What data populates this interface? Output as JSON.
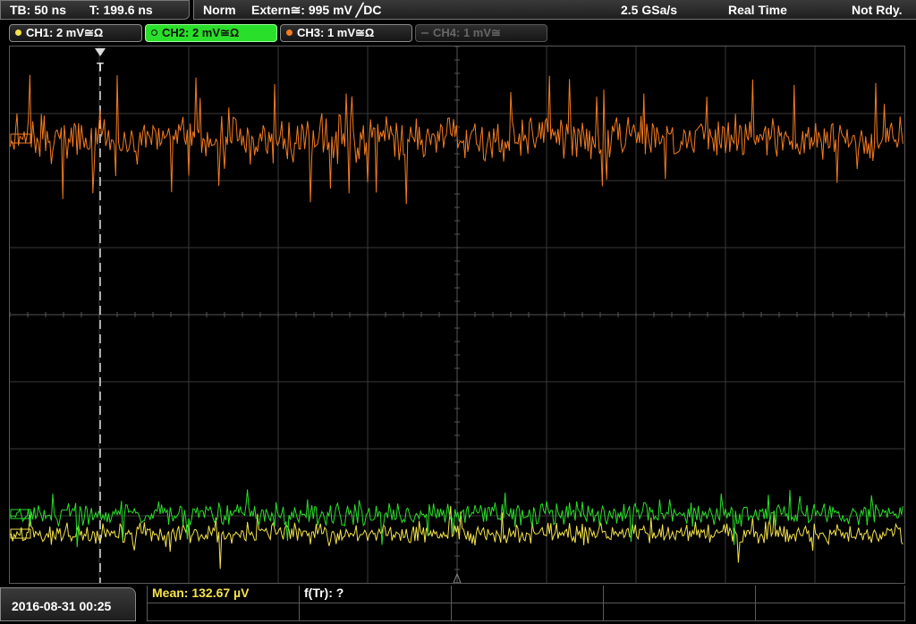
{
  "timebase": {
    "tb": "TB: 50 ns",
    "trig_pos": "T: 199.6 ns"
  },
  "status_bar": {
    "mode": "Norm",
    "trigger": "Extern≅: 995 mV ╱DC",
    "sample_rate": "2.5 GSa/s",
    "acq": "Real Time",
    "state": "Not Rdy."
  },
  "channels": [
    {
      "label": "CH1: 2 mV≅Ω",
      "color": "#f4e34a",
      "state": "normal"
    },
    {
      "label": "CH2: 2 mV≅Ω",
      "color": "#2adf2a",
      "state": "active"
    },
    {
      "label": "CH3: 1 mV≅Ω",
      "color": "#f47c20",
      "state": "normal"
    },
    {
      "label": "CH4: 1 mV≅",
      "color": "#666666",
      "state": "disabled"
    }
  ],
  "trigger_marker": "T",
  "waveform_colors": {
    "ch1": "#f4e34a",
    "ch2": "#2adf2a",
    "ch3": "#f47c20"
  },
  "footer": {
    "datetime": "2016-08-31 00:25",
    "measurements": [
      {
        "text": "Mean: 132.67 µV",
        "color": "#f4e34a"
      },
      {
        "text": "f(Tr): ?",
        "color": "#ffffff"
      }
    ]
  }
}
